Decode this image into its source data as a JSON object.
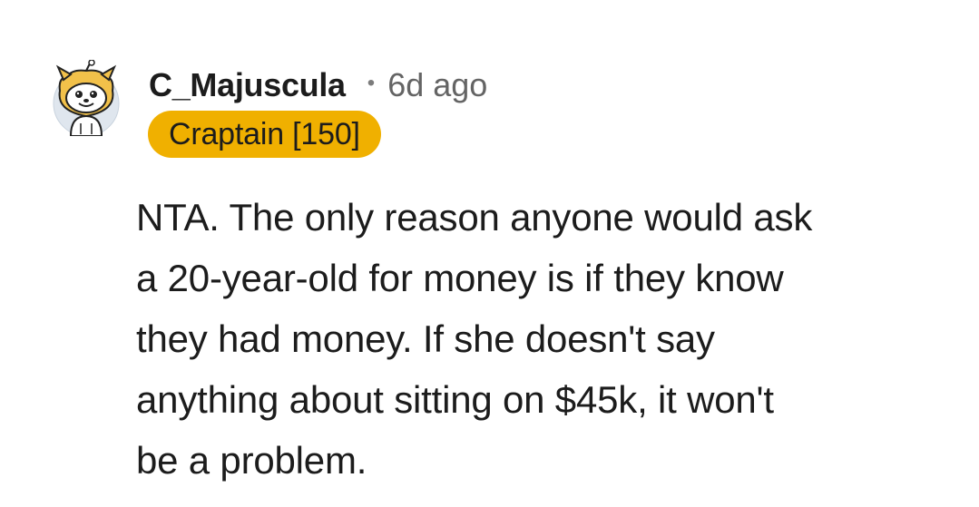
{
  "comment": {
    "username": "C_Majuscula",
    "separator": "•",
    "age": "6d ago",
    "flair": "Craptain [150]",
    "avatar_icon": "snoo-dog-costume-avatar-icon",
    "body_lines": [
      "NTA. The only reason anyone would ask",
      "a 20-year-old for money is if they know",
      "they had money. If she doesn't say",
      "anything about sitting on $45k, it won't",
      "be a problem."
    ]
  },
  "colors": {
    "flair_background": "#f0b000",
    "text": "#1c1c1c",
    "meta_text": "#646464"
  }
}
